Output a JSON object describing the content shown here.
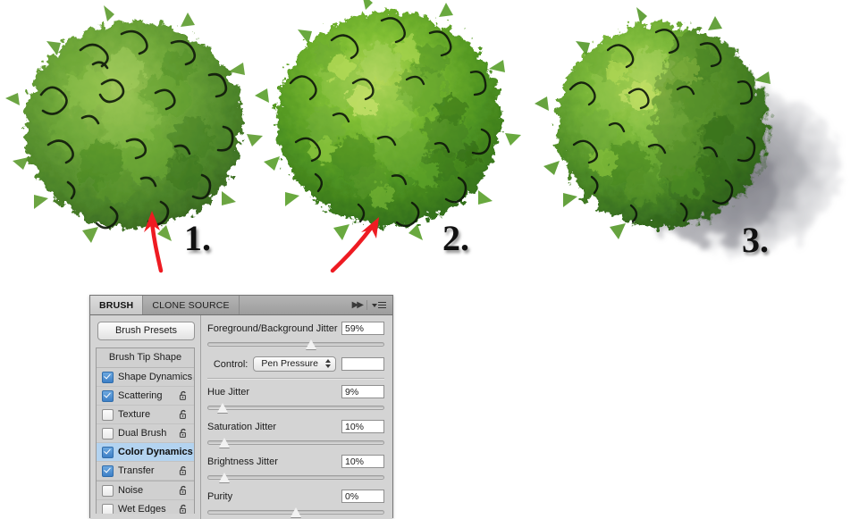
{
  "illustration": {
    "annotations": [
      {
        "id": "num-1",
        "label": "1."
      },
      {
        "id": "num-2",
        "label": "2."
      },
      {
        "id": "num-3",
        "label": "3."
      }
    ],
    "arrow_color": "#ee1b22",
    "tree_colors": {
      "light_green": "#8fc24a",
      "mid_green": "#5a9a32",
      "dark_green": "#2f6420",
      "highlight": "#c3d96a",
      "outline": "#12180c",
      "shadow_gray": "#8a8a8f"
    },
    "trees": [
      {
        "name": "tree-flat-shading"
      },
      {
        "name": "tree-color-dynamics"
      },
      {
        "name": "tree-with-cast-shadow"
      }
    ]
  },
  "panel": {
    "tabs": [
      {
        "label": "BRUSH",
        "active": true
      },
      {
        "label": "CLONE SOURCE",
        "active": false
      }
    ],
    "icons": {
      "collapse": "collapse-chevrons-icon",
      "menu": "panel-menu-icon"
    },
    "presets_button": "Brush Presets",
    "list": {
      "header": "Brush Tip Shape",
      "items": [
        {
          "label": "Shape Dynamics",
          "checked": true,
          "selected": false,
          "locked": false,
          "group_gap": false
        },
        {
          "label": "Scattering",
          "checked": true,
          "selected": false,
          "locked": false,
          "group_gap": false
        },
        {
          "label": "Texture",
          "checked": false,
          "selected": false,
          "locked": false,
          "group_gap": false
        },
        {
          "label": "Dual Brush",
          "checked": false,
          "selected": false,
          "locked": false,
          "group_gap": false
        },
        {
          "label": "Color Dynamics",
          "checked": true,
          "selected": true,
          "locked": false,
          "group_gap": false
        },
        {
          "label": "Transfer",
          "checked": true,
          "selected": false,
          "locked": false,
          "group_gap": false
        },
        {
          "label": "Noise",
          "checked": false,
          "selected": false,
          "locked": false,
          "group_gap": true
        },
        {
          "label": "Wet Edges",
          "checked": false,
          "selected": false,
          "locked": false,
          "group_gap": false
        }
      ]
    },
    "controls": {
      "fg_bg_jitter": {
        "label": "Foreground/Background Jitter",
        "value": "59%",
        "percent": 59
      },
      "control": {
        "label": "Control:",
        "value": "Pen Pressure",
        "extra_value": ""
      },
      "hue_jitter": {
        "label": "Hue Jitter",
        "value": "9%",
        "percent": 9
      },
      "saturation_jitter": {
        "label": "Saturation Jitter",
        "value": "10%",
        "percent": 10
      },
      "brightness_jitter": {
        "label": "Brightness Jitter",
        "value": "10%",
        "percent": 10
      },
      "purity": {
        "label": "Purity",
        "value": "0%",
        "percent": 50
      }
    }
  }
}
